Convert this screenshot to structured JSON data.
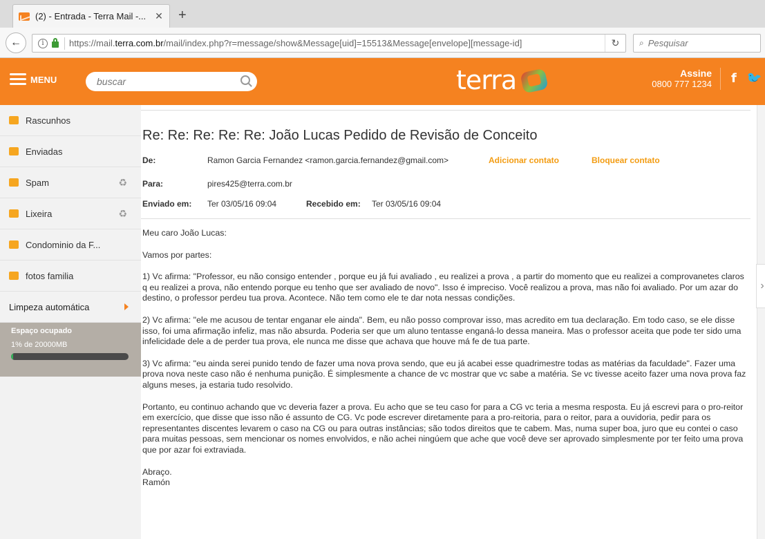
{
  "browser": {
    "tab_title": "(2) - Entrada - Terra Mail -...",
    "tab_close": "✕",
    "new_tab": "+",
    "url_prefix": "https://mail.",
    "url_domain": "terra.com.br",
    "url_rest": "/mail/index.php?r=message/show&Message[uid]=15513&Message[envelope][message-id]",
    "search_placeholder": "Pesquisar"
  },
  "header": {
    "menu_label": "MENU",
    "search_placeholder": "buscar",
    "logo_text": "terra",
    "assine_label": "Assine",
    "phone": "0800 777 1234",
    "facebook": "f",
    "twitter": "🐦"
  },
  "sidebar": {
    "folders": [
      {
        "label": "Rascunhos",
        "icon": "draft-icon"
      },
      {
        "label": "Enviadas",
        "icon": "sent-icon"
      },
      {
        "label": "Spam",
        "icon": "spam-icon"
      },
      {
        "label": "Lixeira",
        "icon": "trash-icon"
      },
      {
        "label": "Condominio da F...",
        "icon": "folder-icon"
      },
      {
        "label": "fotos familia",
        "icon": "folder-icon"
      }
    ],
    "limpeza_label": "Limpeza automática",
    "storage_title": "Espaço ocupado",
    "storage_usage": "1% de 20000MB",
    "storage_fraction": 0.01
  },
  "message": {
    "subject": "Re: Re: Re: Re: Re: João Lucas Pedido de Revisão de Conceito",
    "from_label": "De:",
    "from_value": "Ramon Garcia Fernandez <ramon.garcia.fernandez@gmail.com>",
    "add_contact": "Adicionar contato",
    "block_contact": "Bloquear contato",
    "to_label": "Para:",
    "to_value": "pires425@terra.com.br",
    "sent_label": "Enviado em:",
    "sent_value": "Ter 03/05/16 09:04",
    "received_label": "Recebido em:",
    "received_value": "Ter 03/05/16 09:04",
    "body": {
      "greeting": "Meu caro João Lucas:",
      "intro": "Vamos por partes:",
      "p1": "1) Vc afirma: \"Professor, eu não consigo entender , porque eu já fui avaliado , eu realizei a prova , a partir do momento que eu realizei a comprovanetes claros q eu realizei a prova, não entendo porque eu tenho que ser avaliado de novo\". Isso é impreciso. Você realizou a prova, mas não foi avaliado. Por um azar do destino, o professor perdeu tua prova. Acontece. Não tem como ele te dar nota nessas condições.",
      "p2": "2) Vc afirma: \"ele me acusou de tentar enganar ele ainda\". Bem, eu não posso comprovar isso, mas acredito em tua declaração. Em todo caso, se ele disse isso, foi uma afirmação infeliz, mas não absurda. Poderia ser que um aluno tentasse enganá-lo dessa maneira. Mas o professor aceita que pode ter sido uma infelicidade dele a de perder tua prova, ele nunca me disse que achava que houve má fe de tua parte.",
      "p3": "3) Vc afirma: \"eu ainda serei punido tendo de fazer uma nova prova sendo, que eu já acabei esse quadrimestre todas as matérias da faculdade\". Fazer uma prova nova neste caso não é nenhuma punição. É simplesmente a chance de vc mostrar que vc sabe a matéria. Se vc tivesse aceito fazer uma nova prova faz alguns meses, ja estaria tudo resolvido.",
      "p4": "Portanto, eu continuo achando que vc deveria fazer a prova. Eu acho que se teu caso for para a CG vc teria a mesma resposta. Eu já escrevi para o pro-reitor em exercício, que disse que isso não é assunto de CG. Vc pode escrever diretamente para a pro-reitoria, para o reitor, para a ouvidoria, pedir para os representantes discentes levarem o caso na CG ou para outras instâncias; são todos direitos que te cabem. Mas, numa super boa, juro que eu contei o caso para muitas pessoas, sem mencionar os nomes envolvidos, e não achei ningúem que ache que você deve ser aprovado simplesmente por ter feito uma prova que por azar foi extraviada.",
      "closing": "Abraço.",
      "signature": "Ramón"
    }
  },
  "colors": {
    "brand_orange": "#f58220",
    "link_orange": "#f39c12",
    "storage_green": "#33b05a"
  }
}
